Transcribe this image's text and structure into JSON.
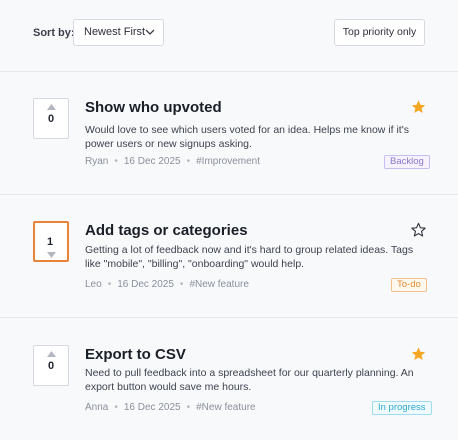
{
  "toolbar": {
    "sort_label": "Sort by:",
    "sort_value": "Newest First",
    "priority_button": "Top priority only"
  },
  "posts": [
    {
      "votes": "0",
      "title": "Show who upvoted",
      "description": "Would love to see which users voted for an idea. Helps me know if it's power users or new signups asking.",
      "author": "Ryan",
      "date": "16 Dec 2025",
      "tag": "#Improvement",
      "status": "Backlog",
      "starred": true,
      "voted": false
    },
    {
      "votes": "1",
      "title": "Add tags or categories",
      "description": "Getting a lot of feedback now and it's hard to group related ideas. Tags like \"mobile\", \"billing\", \"onboarding\" would help.",
      "author": "Leo",
      "date": "16 Dec 2025",
      "tag": "#New feature",
      "status": "To-do",
      "starred": false,
      "voted": true
    },
    {
      "votes": "0",
      "title": "Export to CSV",
      "description": "Need to pull feedback into a spreadsheet for our quarterly planning. An export button would save me hours.",
      "author": "Anna",
      "date": "16 Dec 2025",
      "tag": "#New feature",
      "status": "In progress",
      "starred": true,
      "voted": false
    }
  ],
  "colors": {
    "accent": "#e8843a",
    "star_filled": "#f5a623",
    "backlog": "#8b78c9",
    "todo": "#e08a2e",
    "in_progress": "#2ca8cf"
  }
}
